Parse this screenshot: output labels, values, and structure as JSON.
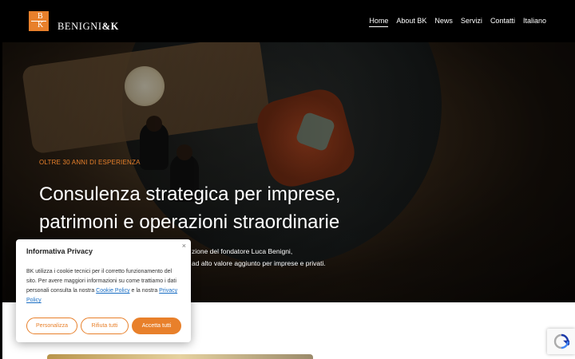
{
  "header": {
    "logo_top_letter": "B",
    "logo_bottom_letter": "K",
    "brand_name": "BENIGNI",
    "brand_amp": "&K",
    "nav": [
      {
        "label": "Home",
        "active": true
      },
      {
        "label": "About BK"
      },
      {
        "label": "News"
      },
      {
        "label": "Servizi"
      },
      {
        "label": "Contatti"
      },
      {
        "label": "Italiano"
      }
    ]
  },
  "hero": {
    "kicker": "OLTRE 30 ANNI DI ESPERIENZA",
    "headline_line1": "Consulenza strategica per imprese,",
    "headline_line2": "patrimoni e operazioni straordinarie",
    "subtext_line1": "zione del fondatore Luca Benigni,",
    "subtext_line2": "ad alto valore aggiunto per imprese e privati."
  },
  "cookie": {
    "title": "Informativa Privacy",
    "close_glyph": "×",
    "text_part1": "BK utilizza i cookie tecnici per il corretto funzionamento del sito. Per avere maggiori informazioni su come trattiamo i dati personali consulta la nostra ",
    "cookie_policy_link": "Cookie Policy",
    "text_part2": " e la nostra ",
    "privacy_policy_link": "Privacy Policy",
    "buttons": {
      "customize": "Personalizza",
      "reject": "Rifiuta tutti",
      "accept": "Accetta tutti"
    }
  },
  "colors": {
    "accent": "#e8802b",
    "background": "#000000",
    "link": "#1a6ec4"
  },
  "icons": {
    "recaptcha": "recaptcha-icon",
    "close": "close-icon"
  }
}
